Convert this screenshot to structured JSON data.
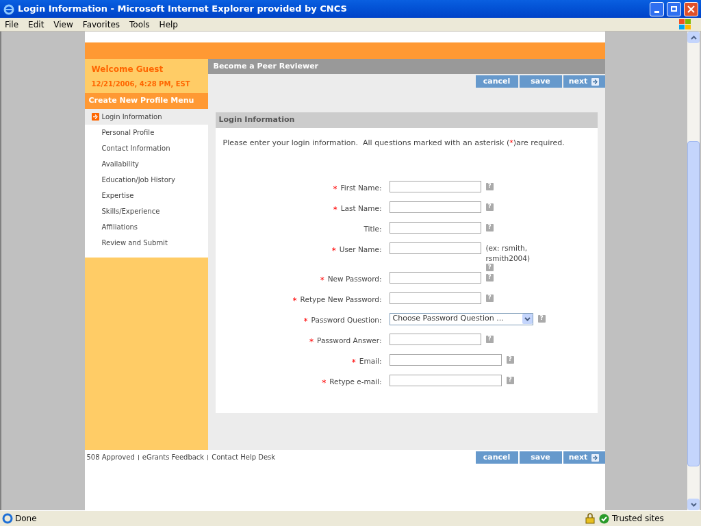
{
  "window": {
    "title": "Login Information - Microsoft Internet Explorer provided by CNCS"
  },
  "menu_bar": [
    "File",
    "Edit",
    "View",
    "Favorites",
    "Tools",
    "Help"
  ],
  "header": {
    "welcome": "Welcome Guest",
    "datetime": "12/21/2006, 4:28 PM, EST"
  },
  "sidebar": {
    "title": "Create New Profile Menu",
    "items": [
      {
        "label": "Login Information",
        "selected": true
      },
      {
        "label": "Personal Profile",
        "selected": false
      },
      {
        "label": "Contact Information",
        "selected": false
      },
      {
        "label": "Availability",
        "selected": false
      },
      {
        "label": "Education/Job History",
        "selected": false
      },
      {
        "label": "Expertise",
        "selected": false
      },
      {
        "label": "Skills/Experience",
        "selected": false
      },
      {
        "label": "Affiliations",
        "selected": false
      },
      {
        "label": "Review and Submit",
        "selected": false
      }
    ]
  },
  "page_title": "Become a Peer Reviewer",
  "top_buttons": [
    {
      "label": "cancel",
      "kind": "plain"
    },
    {
      "label": "save",
      "kind": "plain"
    },
    {
      "label": "next",
      "kind": "next"
    }
  ],
  "panel": {
    "title": "Login Information",
    "instructions": {
      "before": "Please enter your login information.  All questions marked with an asterisk (",
      "mark": "*",
      "after": ")are required."
    },
    "fields": [
      {
        "label": "First Name:",
        "required": true,
        "kind": "text",
        "help": "?"
      },
      {
        "label": "Last Name:",
        "required": true,
        "kind": "text",
        "help": "?"
      },
      {
        "label": "Title:",
        "required": false,
        "kind": "text",
        "help": "?"
      },
      {
        "label": "User Name:",
        "required": true,
        "kind": "text",
        "hint": "(ex: rsmith, rsmith2004)",
        "help": "?"
      },
      {
        "label": "New Password:",
        "required": true,
        "kind": "text",
        "help": "?"
      },
      {
        "label": "Retype New Password:",
        "required": true,
        "kind": "text",
        "help": "?"
      },
      {
        "label": "Password Question:",
        "required": true,
        "kind": "select",
        "value": "Choose Password Question ...",
        "help": "?"
      },
      {
        "label": "Password Answer:",
        "required": true,
        "kind": "text",
        "help": "?"
      },
      {
        "label": "Email:",
        "required": true,
        "kind": "wide",
        "help": "?"
      },
      {
        "label": "Retype e-mail:",
        "required": true,
        "kind": "wide",
        "help": "?"
      }
    ]
  },
  "footer_links": [
    "508 Approved",
    "eGrants Feedback",
    "Contact Help Desk"
  ],
  "bottom_buttons": [
    {
      "label": "cancel",
      "kind": "plain"
    },
    {
      "label": "save",
      "kind": "plain"
    },
    {
      "label": "next",
      "kind": "next"
    }
  ],
  "status_bar": {
    "status": "Done",
    "zone": "Trusted sites"
  }
}
